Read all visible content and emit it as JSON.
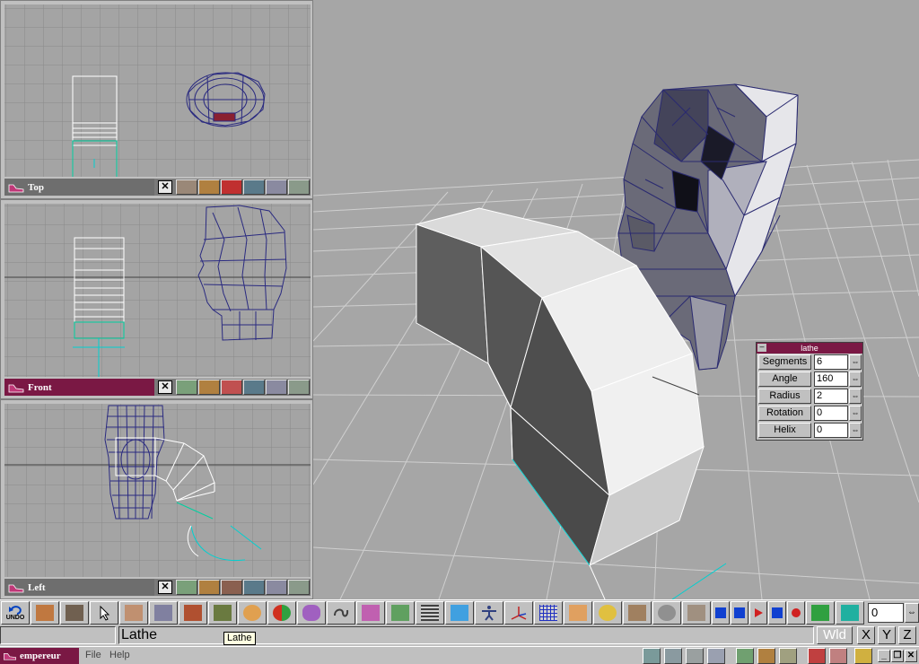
{
  "viewports": {
    "top": {
      "label": "Top"
    },
    "front": {
      "label": "Front"
    },
    "left": {
      "label": "Left"
    }
  },
  "lathe_panel": {
    "title": "lathe",
    "minimize": "–",
    "fields": [
      {
        "label": "Segments",
        "value": "6"
      },
      {
        "label": "Angle",
        "value": "160"
      },
      {
        "label": "Radius",
        "value": "2"
      },
      {
        "label": "Rotation",
        "value": "0"
      },
      {
        "label": "Helix",
        "value": "0"
      }
    ],
    "spin_glyph": "⇔"
  },
  "toolbar": {
    "undo_label": "UNDO",
    "frame_value": "0",
    "frame_spin": "⇔"
  },
  "status": {
    "command": "Lathe",
    "tooltip": "Lathe",
    "coord_mode": "Wld",
    "axis_x": "X",
    "axis_y": "Y",
    "axis_z": "Z"
  },
  "taskbar": {
    "app_name": "empereur",
    "menu_file": "File",
    "menu_help": "Help",
    "close": "✕",
    "restore": "❐",
    "minimize": "_"
  },
  "colors": {
    "accent": "#7a1844",
    "wire": "#2a2a7a",
    "selection": "#ffffff",
    "pivot": "#00c8c8",
    "viewport_bg": "#a4a4a4"
  },
  "icons": {
    "close": "close-icon",
    "shoe": "shoe-logo-icon"
  }
}
